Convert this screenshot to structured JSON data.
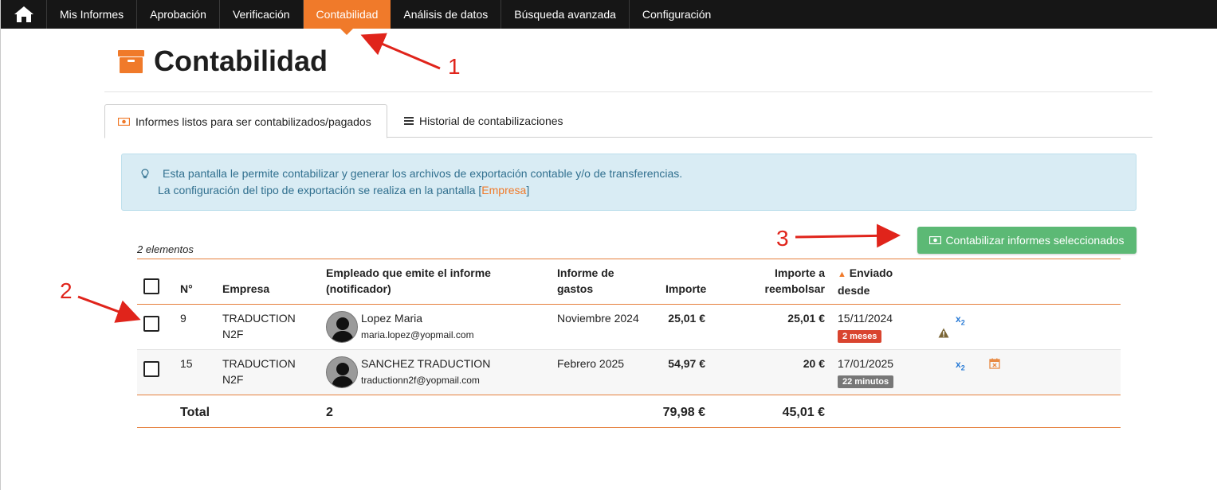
{
  "nav": {
    "home_icon": "home-icon",
    "items": [
      {
        "label": "Mis Informes",
        "active": false
      },
      {
        "label": "Aprobación",
        "active": false
      },
      {
        "label": "Verificación",
        "active": false
      },
      {
        "label": "Contabilidad",
        "active": true
      },
      {
        "label": "Análisis de datos",
        "active": false
      },
      {
        "label": "Búsqueda avanzada",
        "active": false
      },
      {
        "label": "Configuración",
        "active": false
      }
    ],
    "active_color": "#f07a2a",
    "bg_color": "#161616"
  },
  "page": {
    "title": "Contabilidad",
    "title_icon": "archive-box-icon"
  },
  "tabs": [
    {
      "label": "Informes listos para ser contabilizados/pagados",
      "icon": "money-icon",
      "active": true
    },
    {
      "label": "Historial de contabilizaciones",
      "icon": "list-icon",
      "active": false
    }
  ],
  "info": {
    "icon": "lightbulb-icon",
    "line1": "Esta pantalla le permite contabilizar y generar los archivos de exportación contable y/o de transferencias.",
    "line2_prefix": "La configuración del tipo de exportación se realiza en la pantalla [",
    "line2_link": "Empresa",
    "line2_suffix": "]"
  },
  "list": {
    "count_label": "2 elementos",
    "action_button": "Contabilizar informes seleccionados",
    "action_color": "#5cb975"
  },
  "table": {
    "headers": {
      "no": "N°",
      "company": "Empresa",
      "employee_line1": "Empleado que emite el informe",
      "employee_line2": "(notificador)",
      "report_line1": "Informe de",
      "report_line2": "gastos",
      "amount": "Importe",
      "reimburse_line1": "Importe a",
      "reimburse_line2": "reembolsar",
      "sent_line1": "Enviado",
      "sent_line2": "desde",
      "sort_indicator": "▲"
    },
    "rows": [
      {
        "no": "9",
        "company_line1": "TRADUCTION",
        "company_line2": "N2F",
        "employee_name": "Lopez Maria",
        "employee_email": "maria.lopez@yopmail.com",
        "report": "Noviembre 2024",
        "amount": "25,01 €",
        "reimburse": "25,01 €",
        "sent_date": "15/11/2024",
        "sent_badge": "2 meses",
        "badge_color": "red",
        "tag": "x",
        "tag_sub": "2",
        "extra_icon": "warning-icon"
      },
      {
        "no": "15",
        "company_line1": "TRADUCTION",
        "company_line2": "N2F",
        "employee_name": "SANCHEZ TRADUCTION",
        "employee_email": "traductionn2f@yopmail.com",
        "report": "Febrero 2025",
        "amount": "54,97 €",
        "reimburse": "20 €",
        "sent_date": "17/01/2025",
        "sent_badge": "22 minutos",
        "badge_color": "grey",
        "tag": "x",
        "tag_sub": "2",
        "extra_icon": "calendar-x-icon"
      }
    ],
    "total": {
      "label": "Total",
      "count": "2",
      "amount": "79,98 €",
      "reimburse": "45,01 €"
    }
  },
  "annotations": [
    "1",
    "2",
    "3"
  ]
}
